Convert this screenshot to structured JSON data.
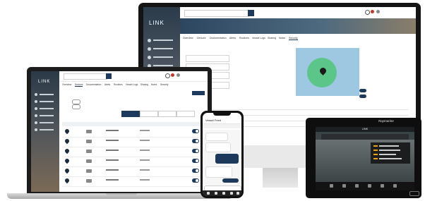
{
  "monitor": {
    "app_logo": "LINK",
    "nav_items": [
      "",
      "",
      "",
      "",
      "",
      "",
      "",
      "",
      ""
    ],
    "tabs": [
      "Overview",
      "Devices",
      "Documentation",
      "Alerts",
      "Routines",
      "Vessel Logs",
      "Sharing",
      "Notes",
      "Security"
    ],
    "brand": "Raymarine"
  },
  "laptop": {
    "app_logo": "LINK",
    "tabs": [
      "Overview",
      "Devices",
      "Documentation",
      "Alerts",
      "Routines",
      "Vessel Logs",
      "Sharing",
      "Notes",
      "Security"
    ],
    "rows": 7
  },
  "phone": {
    "title": "Vessel Feed"
  },
  "mfd": {
    "brand": "Raymarine",
    "title": "LINK"
  },
  "colors": {
    "navy": "#1d3a5c",
    "geofence_green": "#5cc58a",
    "map_water": "#9ec8e2",
    "accent_orange": "#f0a500"
  }
}
